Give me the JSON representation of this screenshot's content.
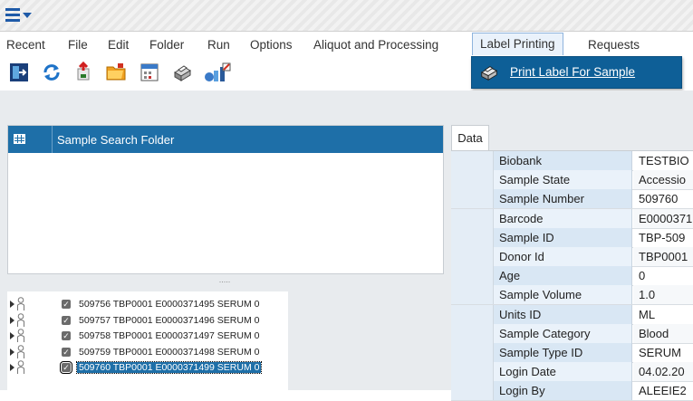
{
  "menubar": {
    "recent": "Recent",
    "file": "File",
    "edit": "Edit",
    "folder": "Folder",
    "run": "Run",
    "options": "Options",
    "aliquot": "Aliquot and Processing",
    "label_printing": "Label Printing",
    "requests": "Requests"
  },
  "toolbar": {
    "icons": [
      "exit-icon",
      "refresh-icon",
      "transfer-icon",
      "folder-open-icon",
      "calendar-icon",
      "printer-icon",
      "sample-edit-icon"
    ]
  },
  "dropdown": {
    "print_label": "Print Label For Sample"
  },
  "folder": {
    "title": "Sample Search Folder",
    "splitter": "....."
  },
  "samples": [
    {
      "text": "509756 TBP0001 E0000371495 SERUM 0",
      "checked": true,
      "selected": false
    },
    {
      "text": "509757 TBP0001 E0000371496 SERUM 0",
      "checked": true,
      "selected": false
    },
    {
      "text": "509758 TBP0001 E0000371497 SERUM 0",
      "checked": true,
      "selected": false
    },
    {
      "text": "509759 TBP0001 E0000371498 SERUM 0",
      "checked": true,
      "selected": false
    },
    {
      "text": "509760 TBP0001 E0000371499 SERUM 0",
      "checked": true,
      "selected": true
    }
  ],
  "data_tab": {
    "label": "Data"
  },
  "fields": [
    {
      "label": "Biobank",
      "value": "TESTBIO"
    },
    {
      "label": "Sample State",
      "value": "Accessio"
    },
    {
      "label": "Sample Number",
      "value": "509760"
    },
    {
      "label": "Barcode",
      "value": "E0000371"
    },
    {
      "label": "Sample ID",
      "value": "TBP-509"
    },
    {
      "label": "Donor Id",
      "value": "TBP0001"
    },
    {
      "label": "Age",
      "value": "0"
    },
    {
      "label": "Sample Volume",
      "value": "1.0"
    },
    {
      "label": "Units ID",
      "value": "ML"
    },
    {
      "label": "Sample Category",
      "value": "Blood"
    },
    {
      "label": "Sample Type ID",
      "value": "SERUM"
    },
    {
      "label": "Login Date",
      "value": "04.02.20"
    },
    {
      "label": "Login By",
      "value": "ALEEIE2"
    }
  ]
}
